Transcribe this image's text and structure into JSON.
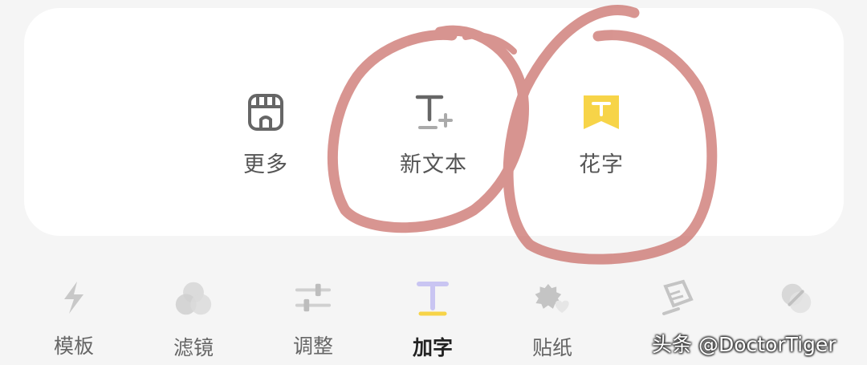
{
  "text_options": [
    {
      "label": "更多",
      "icon": "store-icon"
    },
    {
      "label": "新文本",
      "icon": "text-add-icon"
    },
    {
      "label": "花字",
      "icon": "fancy-text-icon"
    }
  ],
  "toolbar": [
    {
      "label": "模板",
      "icon": "lightning-icon"
    },
    {
      "label": "滤镜",
      "icon": "filter-circles-icon"
    },
    {
      "label": "调整",
      "icon": "adjust-sliders-icon"
    },
    {
      "label": "加字",
      "icon": "add-text-icon",
      "active": true
    },
    {
      "label": "贴纸",
      "icon": "sticker-icon"
    },
    {
      "label": "",
      "icon": "edit-icon"
    },
    {
      "label": "",
      "icon": "overlay-icon"
    }
  ],
  "watermark": "头条 @DoctorTiger",
  "colors": {
    "accent_yellow": "#f7d448",
    "accent_purple": "#c9c5f2",
    "annotation_red": "#c96c66"
  }
}
